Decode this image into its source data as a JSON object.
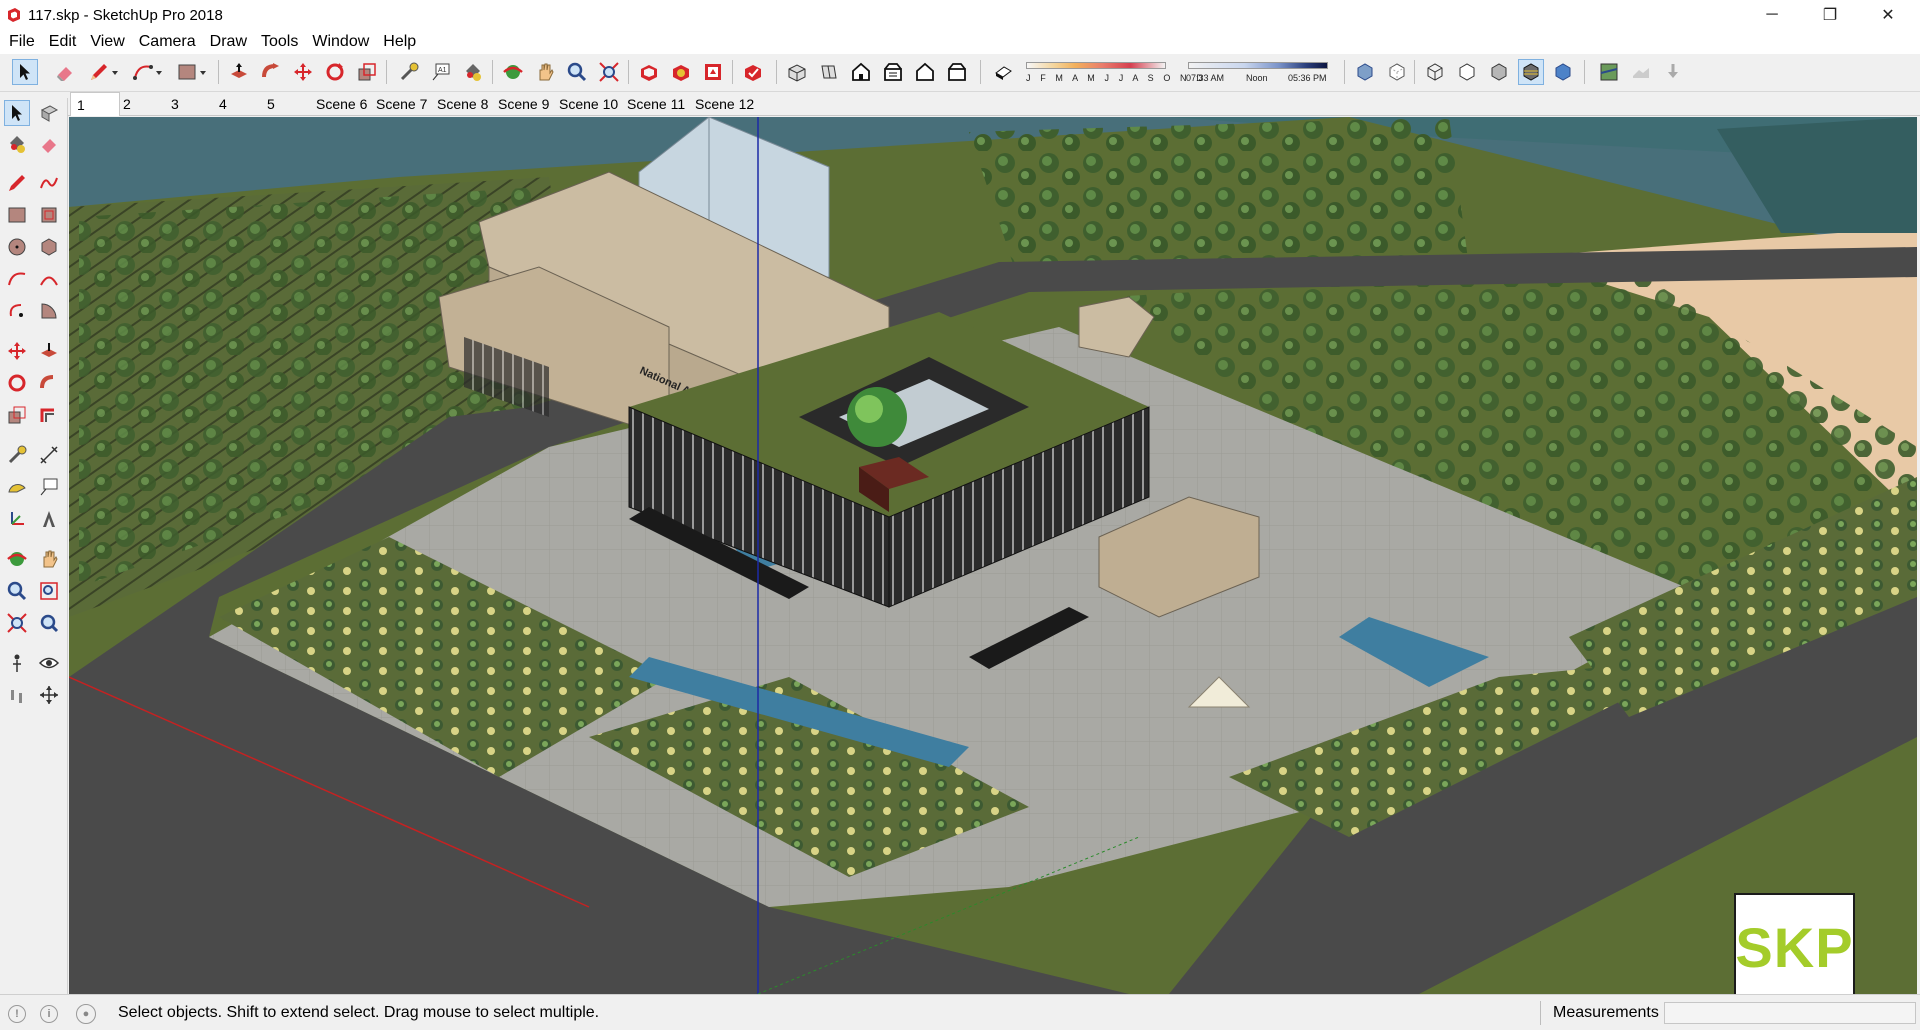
{
  "window": {
    "title": "117.skp - SketchUp Pro 2018",
    "controls": {
      "minimize": "─",
      "maximize": "❐",
      "close": "✕"
    }
  },
  "menu": [
    "File",
    "Edit",
    "View",
    "Camera",
    "Draw",
    "Tools",
    "Window",
    "Help"
  ],
  "shadow_settings": {
    "months": "J F M A M J J A S O N D",
    "time_start": "07:33 AM",
    "time_mid": "Noon",
    "time_end": "05:36 PM"
  },
  "scenes": [
    {
      "label": "1",
      "active": true
    },
    {
      "label": "2"
    },
    {
      "label": "3"
    },
    {
      "label": "4"
    },
    {
      "label": "5"
    },
    {
      "label": "Scene 6"
    },
    {
      "label": "Scene 7"
    },
    {
      "label": "Scene 8"
    },
    {
      "label": "Scene 9"
    },
    {
      "label": "Scene 10"
    },
    {
      "label": "Scene 11"
    },
    {
      "label": "Scene 12"
    }
  ],
  "model": {
    "building_sign": "National Archives Center"
  },
  "watermark": "SKP",
  "status": {
    "message": "Select objects. Shift to extend select. Drag mouse to select multiple.",
    "measurements_label": "Measurements",
    "measurements_value": ""
  },
  "colors": {
    "grass": "#5c6e34",
    "road": "#4a4a4a",
    "water": "#486f7a",
    "building": "#c9b79c",
    "accent_logo": "#a4cc2a"
  }
}
